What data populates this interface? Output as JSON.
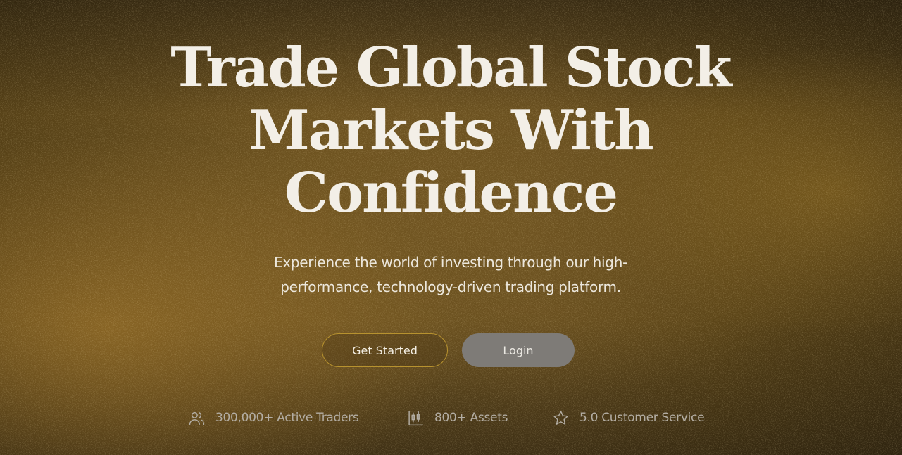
{
  "hero": {
    "title_lines": [
      "Trade Global Stock",
      "Markets With",
      "Confidence"
    ],
    "subtitle_lines": [
      "Experience the world of investing through our high-",
      "performance, technology-driven trading platform."
    ]
  },
  "buttons": {
    "primary_label": "Get Started",
    "secondary_label": "Login"
  },
  "stats": [
    {
      "icon": "users-icon",
      "label": "300,000+ Active Traders"
    },
    {
      "icon": "chart-icon",
      "label": "800+ Assets"
    },
    {
      "icon": "star-icon",
      "label": "5.0 Customer Service"
    }
  ],
  "colors": {
    "title": "#f3efe7",
    "accent_border": "#b7922f",
    "secondary_button": "#7e7b77",
    "stat_text": "#b3ada3"
  }
}
